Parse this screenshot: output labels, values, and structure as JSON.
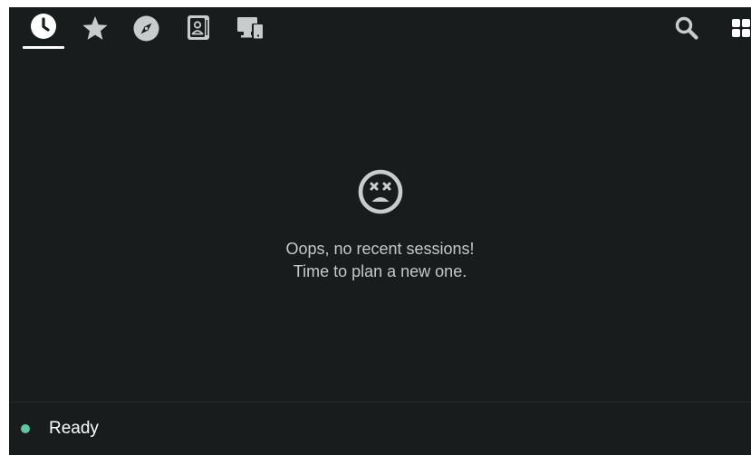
{
  "nav": {
    "tabs": [
      {
        "icon": "clock-icon",
        "active": true
      },
      {
        "icon": "star-icon",
        "active": false
      },
      {
        "icon": "compass-icon",
        "active": false
      },
      {
        "icon": "contact-card-icon",
        "active": false
      },
      {
        "icon": "devices-icon",
        "active": false
      }
    ],
    "right_icons": [
      "search-icon",
      "grid-icon"
    ]
  },
  "empty_state": {
    "icon": "dizzy-face-icon",
    "line1": "Oops, no recent sessions!",
    "line2": "Time to plan a new one."
  },
  "status": {
    "text": "Ready",
    "color": "#5fc8a3"
  },
  "colors": {
    "background": "#181c1c",
    "icon": "#c9cccc",
    "text": "#c4c8c8",
    "accent_underline": "#ffffff"
  }
}
